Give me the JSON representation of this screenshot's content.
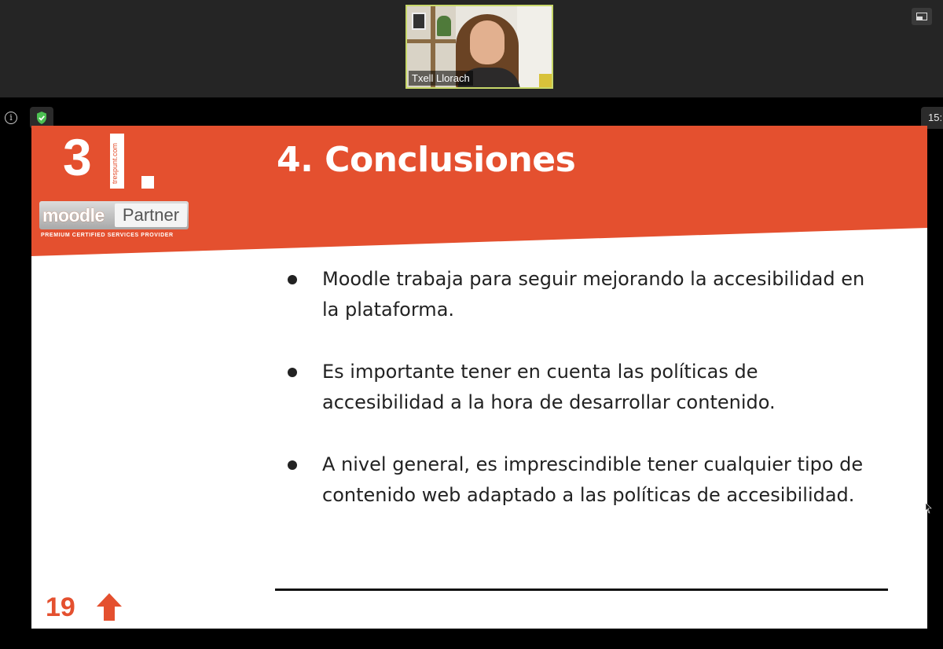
{
  "participant": {
    "name": "Txell Llorach"
  },
  "toolbar": {
    "view_icon": "gallery-view-icon",
    "info_icon": "info-icon",
    "shield_icon": "shield-check-icon",
    "time_text": "15:"
  },
  "slide": {
    "logo": {
      "number": "3",
      "site": "trespunt.com",
      "moodle": "moodle",
      "partner": "Partner",
      "tagline": "PREMIUM CERTIFIED SERVICES PROVIDER"
    },
    "title": "4. Conclusiones",
    "bullets": [
      "Moodle trabaja para seguir mejorando la accesibilidad en la plataforma.",
      "Es importante tener en cuenta las políticas de accesibilidad a la hora de desarrollar contenido.",
      "A nivel general, es imprescindible tener cualquier tipo de contenido web adaptado a las políticas de accesibilidad."
    ],
    "page_number": "19",
    "arrow_icon": "arrow-up-icon"
  },
  "colors": {
    "accent": "#e4502f",
    "toolbar_bg": "#252525",
    "highlight_border": "#c8d86a",
    "shield": "#4cc152"
  }
}
